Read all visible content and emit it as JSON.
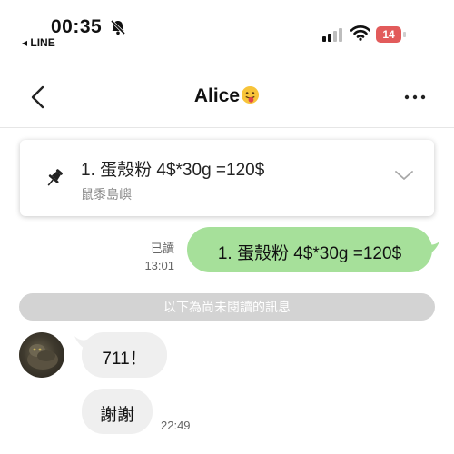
{
  "status_bar": {
    "time": "00:35",
    "back_app": "◂ LINE",
    "battery": "14",
    "battery_color": "#e25b5b"
  },
  "header": {
    "title": "Alice"
  },
  "pinned": {
    "text": "1. 蛋殼粉 4$*30g =120$",
    "sub": "鼠黍島嶼"
  },
  "messages": {
    "outgoing": {
      "read_label": "已讀",
      "time": "13:01",
      "text": "1. 蛋殼粉 4$*30g =120$",
      "color": "#a6e09a"
    },
    "unread_divider": "以下為尚未閱讀的訊息",
    "incoming": [
      {
        "text": "711！"
      },
      {
        "text": "謝謝",
        "time": "22:49"
      }
    ]
  }
}
